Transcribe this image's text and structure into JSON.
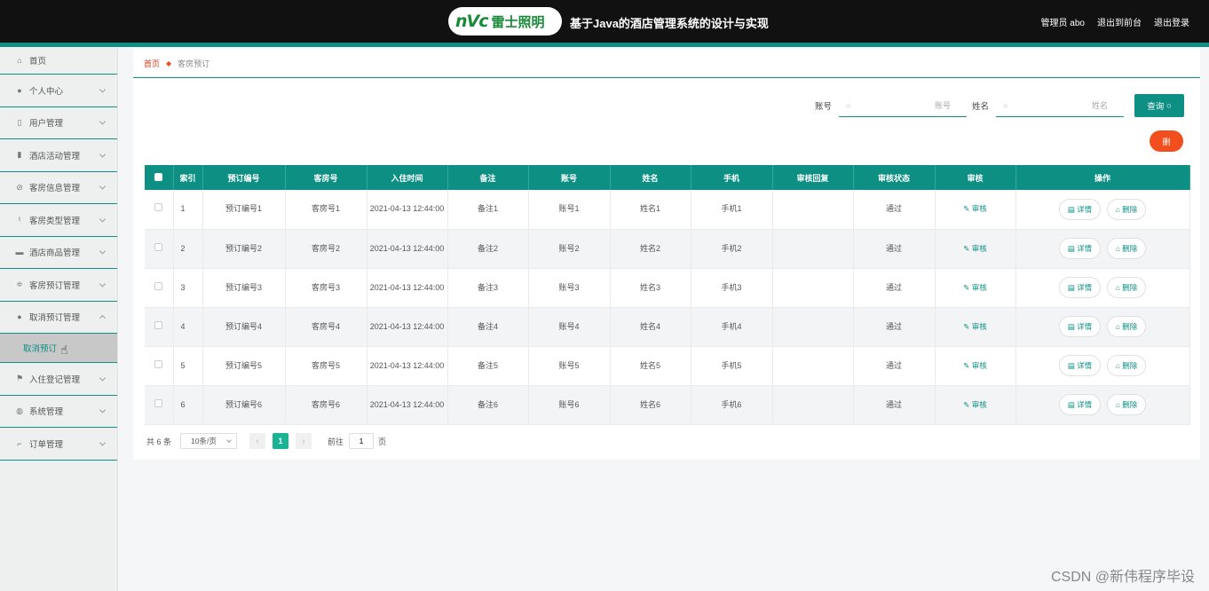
{
  "header": {
    "logo_mark": "nVc",
    "logo_text": "雷士照明",
    "title": "基于Java的酒店管理系统的设计与实现",
    "links": [
      "管理员 abo",
      "退出到前台",
      "退出登录"
    ]
  },
  "sidebar": {
    "items": [
      {
        "label": "首页",
        "icon": "home-icon"
      },
      {
        "label": "个人中心",
        "icon": "user-icon"
      },
      {
        "label": "用户管理",
        "icon": "mic-icon"
      },
      {
        "label": "酒店活动管理",
        "icon": "bar-chart-icon"
      },
      {
        "label": "客房信息管理",
        "icon": "slash-icon"
      },
      {
        "label": "客房类型管理",
        "icon": "microphone-icon"
      },
      {
        "label": "酒店商品管理",
        "icon": "bag-icon"
      },
      {
        "label": "客房预订管理",
        "icon": "sliders-icon"
      },
      {
        "label": "取消预订管理",
        "icon": "pin-icon"
      },
      {
        "label": "入住登记管理",
        "icon": "flag-icon"
      },
      {
        "label": "系统管理",
        "icon": "globe-icon"
      },
      {
        "label": "订单管理",
        "icon": "crop-icon"
      }
    ],
    "sub_item": "取消预订"
  },
  "breadcrumb": {
    "home": "首页",
    "current": "客房预订"
  },
  "search": {
    "account_label": "账号",
    "account_placeholder": "账号",
    "name_label": "姓名",
    "name_placeholder": "姓名",
    "query_button": "查询"
  },
  "bulk_delete_label": "删",
  "table": {
    "headers": [
      "索引",
      "预订编号",
      "客房号",
      "入住时间",
      "备注",
      "账号",
      "姓名",
      "手机",
      "审核回复",
      "审核状态",
      "审核",
      "操作"
    ],
    "rows": [
      {
        "idx": "1",
        "no": "预订编号1",
        "room": "客房号1",
        "time": "2021-04-13 12:44:00",
        "note": "备注1",
        "acct": "账号1",
        "name": "姓名1",
        "phone": "手机1",
        "reply": "",
        "status": "通过"
      },
      {
        "idx": "2",
        "no": "预订编号2",
        "room": "客房号2",
        "time": "2021-04-13 12:44:00",
        "note": "备注2",
        "acct": "账号2",
        "name": "姓名2",
        "phone": "手机2",
        "reply": "",
        "status": "通过"
      },
      {
        "idx": "3",
        "no": "预订编号3",
        "room": "客房号3",
        "time": "2021-04-13 12:44:00",
        "note": "备注3",
        "acct": "账号3",
        "name": "姓名3",
        "phone": "手机3",
        "reply": "",
        "status": "通过"
      },
      {
        "idx": "4",
        "no": "预订编号4",
        "room": "客房号4",
        "time": "2021-04-13 12:44:00",
        "note": "备注4",
        "acct": "账号4",
        "name": "姓名4",
        "phone": "手机4",
        "reply": "",
        "status": "通过"
      },
      {
        "idx": "5",
        "no": "预订编号5",
        "room": "客房号5",
        "time": "2021-04-13 12:44:00",
        "note": "备注5",
        "acct": "账号5",
        "name": "姓名5",
        "phone": "手机5",
        "reply": "",
        "status": "通过"
      },
      {
        "idx": "6",
        "no": "预订编号6",
        "room": "客房号6",
        "time": "2021-04-13 12:44:00",
        "note": "备注6",
        "acct": "账号6",
        "name": "姓名6",
        "phone": "手机6",
        "reply": "",
        "status": "通过"
      }
    ],
    "audit_label": "审核",
    "detail_label": "详情",
    "delete_label": "删除"
  },
  "pagination": {
    "total": "共 6 条",
    "page_size": "10条/页",
    "current_page": "1",
    "goto_label": "前往",
    "goto_value": "1",
    "page_suffix": "页"
  },
  "watermark": "CSDN @新伟程序毕设"
}
